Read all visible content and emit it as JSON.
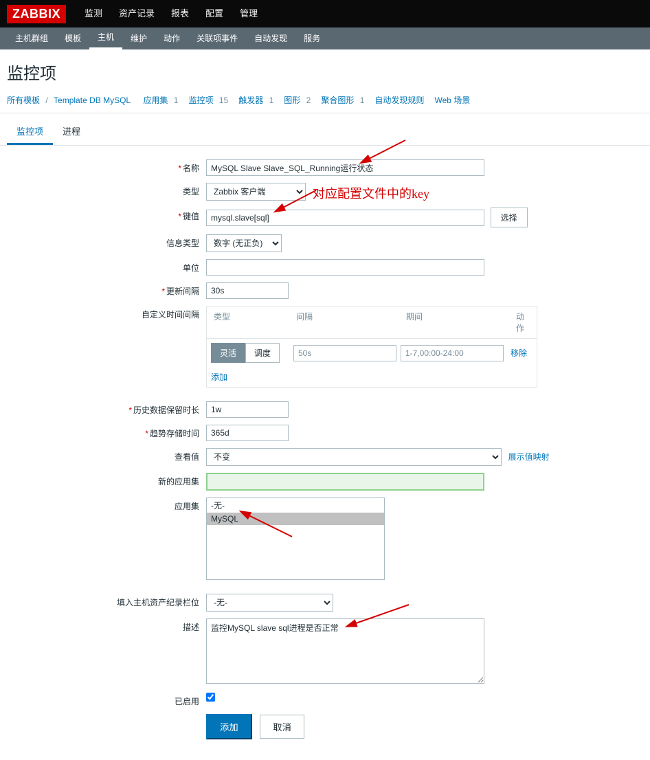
{
  "logo": "ZABBIX",
  "topnav": {
    "items": [
      "监测",
      "资产记录",
      "报表",
      "配置",
      "管理"
    ]
  },
  "subnav": {
    "items": [
      "主机群组",
      "模板",
      "主机",
      "维护",
      "动作",
      "关联项事件",
      "自动发现",
      "服务"
    ],
    "active_index": 2
  },
  "page_title": "监控项",
  "breadcrumb": {
    "all_templates": "所有模板",
    "template_name": "Template DB MySQL",
    "links": [
      {
        "label": "应用集",
        "count": "1"
      },
      {
        "label": "监控项",
        "count": "15"
      },
      {
        "label": "触发器",
        "count": "1"
      },
      {
        "label": "图形",
        "count": "2"
      },
      {
        "label": "聚合图形",
        "count": "1"
      },
      {
        "label": "自动发现规则",
        "count": ""
      },
      {
        "label": "Web 场景",
        "count": ""
      }
    ]
  },
  "tabs": {
    "items": [
      "监控项",
      "进程"
    ],
    "active_index": 0
  },
  "form": {
    "name_label": "名称",
    "name_value": "MySQL Slave Slave_SQL_Running运行状态",
    "type_label": "类型",
    "type_value": "Zabbix 客户端",
    "key_label": "键值",
    "key_value": "mysql.slave[sql]",
    "key_select_btn": "选择",
    "infotype_label": "信息类型",
    "infotype_value": "数字 (无正负)",
    "unit_label": "单位",
    "unit_value": "",
    "update_label": "更新间隔",
    "update_value": "30s",
    "custom_interval_label": "自定义时间间隔",
    "interval_headers": {
      "type": "类型",
      "interval": "间隔",
      "period": "期间",
      "action": "动作"
    },
    "interval_toggle": {
      "flexible": "灵活",
      "scheduling": "调度"
    },
    "interval_value": "50s",
    "period_value": "1-7,00:00-24:00",
    "remove": "移除",
    "add": "添加",
    "history_label": "历史数据保留时长",
    "history_value": "1w",
    "trend_label": "趋势存储时间",
    "trend_value": "365d",
    "showvalue_label": "查看值",
    "showvalue_value": "不变",
    "showvalue_link": "展示值映射",
    "newapp_label": "新的应用集",
    "newapp_value": "",
    "apps_label": "应用集",
    "apps_options": {
      "none": "-无-",
      "mysql": "MySQL"
    },
    "inventory_label": "填入主机资产纪录栏位",
    "inventory_value": "-无-",
    "desc_label": "描述",
    "desc_value": "监控MySQL slave sql进程是否正常",
    "enabled_label": "已启用",
    "submit": "添加",
    "cancel": "取消"
  },
  "annotations": {
    "key_note": "对应配置文件中的key"
  }
}
